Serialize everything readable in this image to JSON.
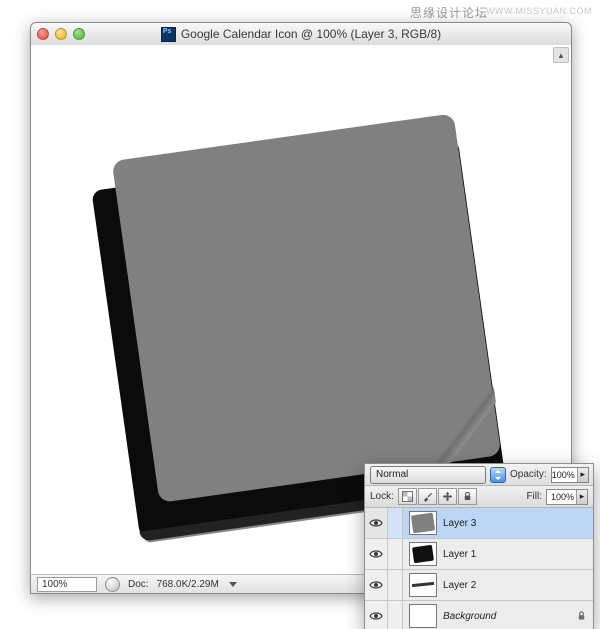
{
  "watermark": {
    "cn": "思缘设计论坛",
    "en": "WWW.MISSYUAN.COM"
  },
  "window": {
    "title": "Google Calendar Icon @ 100% (Layer 3, RGB/8)"
  },
  "statusbar": {
    "zoom": "100%",
    "doc_label": "Doc:",
    "doc_value": "768.0K/2.29M"
  },
  "layers_panel": {
    "blend_mode": "Normal",
    "opacity_label": "Opacity:",
    "opacity_value": "100%",
    "lock_label": "Lock:",
    "fill_label": "Fill:",
    "fill_value": "100%",
    "layers": [
      {
        "name": "Layer 3",
        "selected": true,
        "thumb": "gray",
        "italic": false,
        "locked": false
      },
      {
        "name": "Layer 1",
        "selected": false,
        "thumb": "black",
        "italic": false,
        "locked": false
      },
      {
        "name": "Layer 2",
        "selected": false,
        "thumb": "line",
        "italic": false,
        "locked": false
      },
      {
        "name": "Background",
        "selected": false,
        "thumb": "white",
        "italic": true,
        "locked": true
      }
    ]
  }
}
